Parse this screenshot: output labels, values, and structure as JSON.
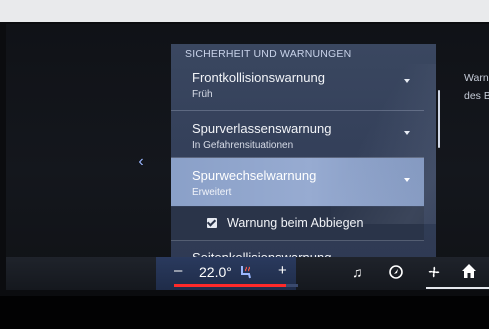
{
  "settings_panel": {
    "header": "SICHERHEIT UND WARNUNGEN",
    "items": [
      {
        "title": "Frontkollisionswarnung",
        "subtitle": "Früh"
      },
      {
        "title": "Spurverlassenswarnung",
        "subtitle": "In Gefahrensituationen"
      },
      {
        "title": "Spurwechselwarnung",
        "subtitle": "Erweitert"
      }
    ],
    "sub_item": {
      "label": "Warnung beim Abbiegen",
      "checked": true
    },
    "last_item": {
      "title": "Seitenkollisionswarnung"
    }
  },
  "right_info": {
    "line1": "Warnu",
    "line2": "des B"
  },
  "climate": {
    "minus": "–",
    "temperature": "22.0°",
    "plus": "+",
    "temp_level_fraction": 0.9
  },
  "dock_icons": [
    "music-icon",
    "navigation-icon",
    "fan-icon",
    "home-icon"
  ],
  "colors": {
    "accent_blue": "#9bb7ff",
    "selected_row": "#8aa0c8",
    "temp_red": "#ff2a2a"
  }
}
